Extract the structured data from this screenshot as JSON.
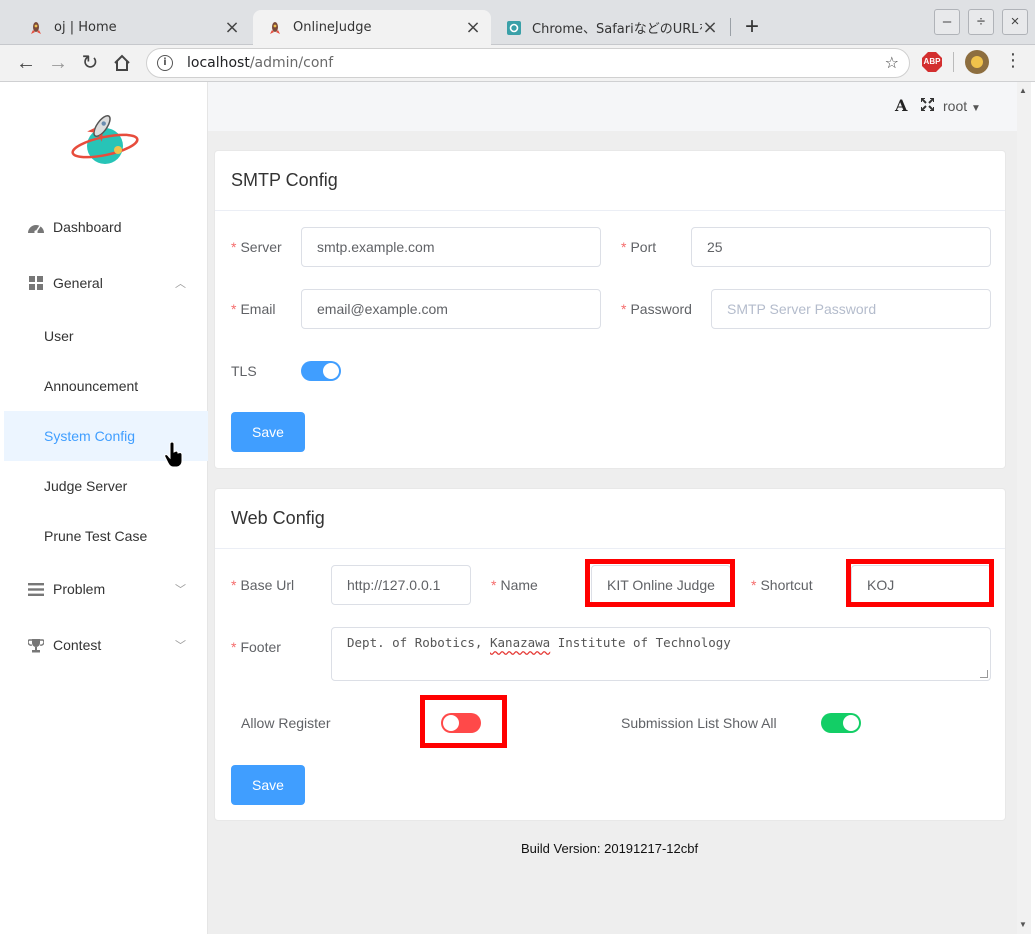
{
  "browser": {
    "tabs": [
      {
        "title": "oj | Home",
        "active": false
      },
      {
        "title": "OnlineJudge",
        "active": true
      },
      {
        "title": "Chrome、SafariなどのURLを入...",
        "active": false
      }
    ],
    "new_tab": "+",
    "window_controls": {
      "minimize": "–",
      "restore": "÷",
      "close": "×"
    },
    "url_host": "localhost",
    "url_path": "/admin/conf",
    "abp_label": "ABP"
  },
  "sidebar": {
    "items": [
      {
        "label": "Dashboard",
        "icon": "dashboard-icon"
      },
      {
        "label": "General",
        "icon": "grid-icon",
        "expanded": true
      },
      {
        "label": "Problem",
        "icon": "list-icon",
        "expanded": false
      },
      {
        "label": "Contest",
        "icon": "trophy-icon",
        "expanded": false
      }
    ],
    "general_sub": [
      "User",
      "Announcement",
      "System Config",
      "Judge Server",
      "Prune Test Case"
    ],
    "active_sub": "System Config"
  },
  "topbar": {
    "font_icon": "A",
    "username": "root"
  },
  "smtp": {
    "title": "SMTP Config",
    "server_label": "Server",
    "server_value": "smtp.example.com",
    "port_label": "Port",
    "port_value": "25",
    "email_label": "Email",
    "email_value": "email@example.com",
    "password_label": "Password",
    "password_placeholder": "SMTP Server Password",
    "tls_label": "TLS",
    "tls_on": true,
    "save_label": "Save"
  },
  "web": {
    "title": "Web Config",
    "base_url_label": "Base Url",
    "base_url_value": "http://127.0.0.1",
    "name_label": "Name",
    "name_value": "KIT Online Judge",
    "shortcut_label": "Shortcut",
    "shortcut_value": "KOJ",
    "footer_label": "Footer",
    "footer_pre": "Dept. of Robotics, ",
    "footer_mid": "Kanazawa",
    "footer_post": " Institute of Technology",
    "allow_register_label": "Allow Register",
    "allow_register_on": false,
    "submission_list_label": "Submission List Show All",
    "submission_list_on": true,
    "save_label": "Save"
  },
  "build_version": "Build Version: 20191217-12cbf",
  "colors": {
    "primary": "#409eff",
    "switch_off_highlighted": "#ff4949",
    "switch_on_green": "#13ce66",
    "annotation_red": "#ff0000"
  }
}
